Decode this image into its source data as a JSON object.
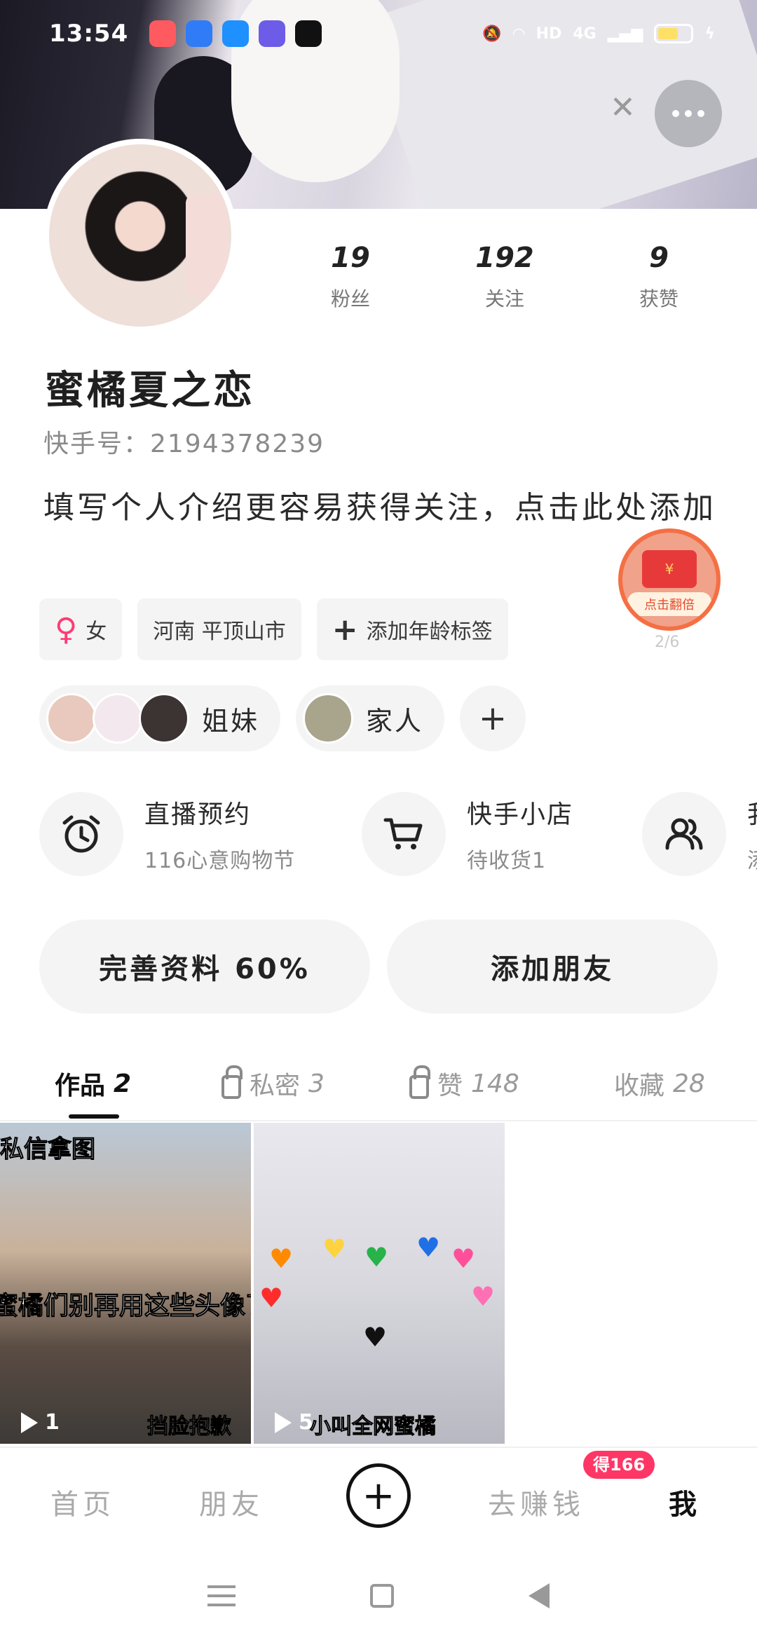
{
  "status_bar": {
    "time": "13:54",
    "network": "HD",
    "signal": "4G"
  },
  "cover": {
    "more_icon": "more-horizontal-icon",
    "close_icon": "close-icon"
  },
  "profile": {
    "stats": [
      {
        "value": "19",
        "label": "粉丝"
      },
      {
        "value": "192",
        "label": "关注"
      },
      {
        "value": "9",
        "label": "获赞"
      }
    ],
    "nickname": "蜜橘夏之恋",
    "kwai_id": "快手号：2194378239",
    "bio": "填写个人介绍更容易获得关注，点击此处添加",
    "red_packet": {
      "text": "点击翻倍",
      "symbol": "¥",
      "count": "2/6"
    }
  },
  "tags": {
    "gender": "女",
    "location": "河南 平顶山市",
    "add_age": "添加年龄标签"
  },
  "groups": [
    {
      "label": "姐妹"
    },
    {
      "label": "家人"
    }
  ],
  "shortcuts": [
    {
      "title": "直播预约",
      "subtitle": "116心意购物节",
      "icon": "alarm-clock-icon"
    },
    {
      "title": "快手小店",
      "subtitle": "待收货1",
      "icon": "shopping-cart-icon"
    },
    {
      "title": "我的",
      "subtitle": "添加",
      "icon": "users-icon"
    }
  ],
  "actions": {
    "complete_profile": "完善资料 60%",
    "add_friends": "添加朋友"
  },
  "content_tabs": [
    {
      "label": "作品",
      "count": "2"
    },
    {
      "label": "私密",
      "count": "3"
    },
    {
      "label": "赞",
      "count": "148"
    },
    {
      "label": "收藏",
      "count": "28"
    }
  ],
  "videos": [
    {
      "caption": "蜜橘们别再用这些头像了",
      "corner_text": "私信拿图",
      "plays": "1",
      "watermark": "挡脸抱歉"
    },
    {
      "caption": "",
      "corner_text": "",
      "plays": "5",
      "watermark": "小叫全网蜜橘"
    }
  ],
  "bottom_nav": {
    "home": "首页",
    "friends": "朋友",
    "earn": "去赚钱",
    "earn_badge": "得166",
    "me": "我"
  }
}
